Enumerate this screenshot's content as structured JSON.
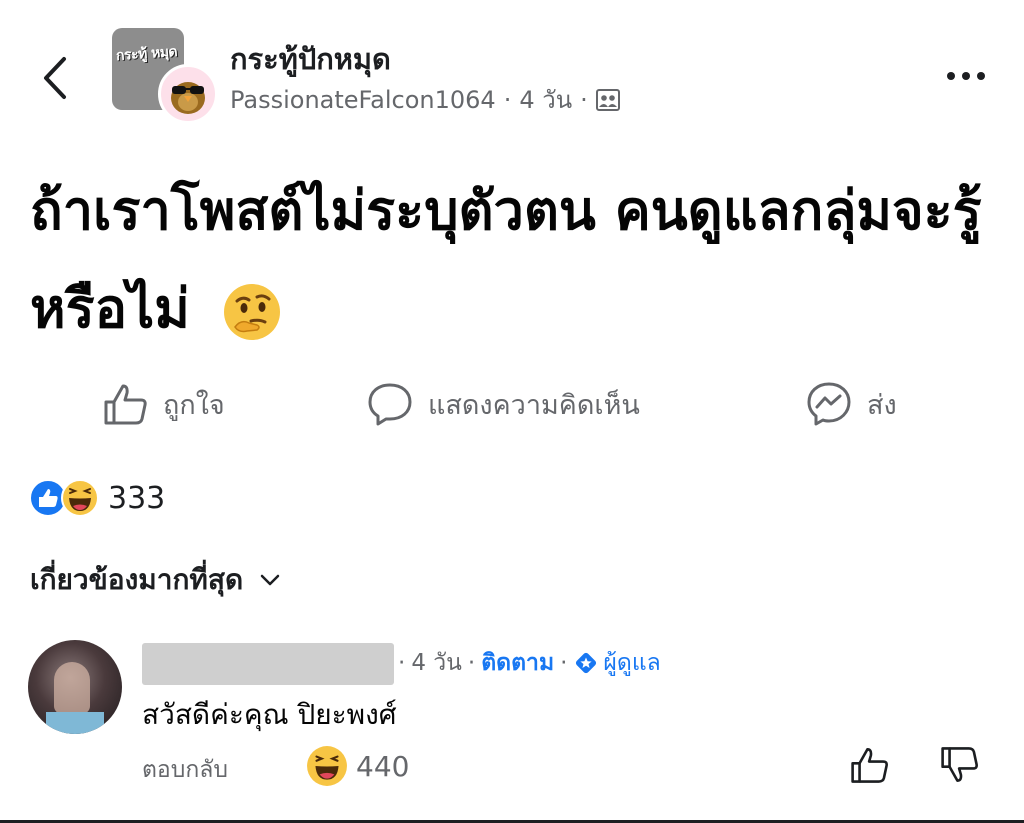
{
  "header": {
    "group_name": "กระทู้ปักหมุด",
    "group_thumb_label": "กระทู้ หมุด",
    "author": "PassionateFalcon1064",
    "time": "4 วัน"
  },
  "post": {
    "text": "ถ้าเราโพสต์ไม่ระบุตัวตน คนดูแลกลุ่มจะรู้หรือไม่"
  },
  "actions": {
    "like_label": "ถูกใจ",
    "comment_label": "แสดงความคิดเห็น",
    "share_label": "ส่ง"
  },
  "reactions": {
    "count": "333"
  },
  "sort": {
    "label": "เกี่ยวข้องมากที่สุด"
  },
  "comment": {
    "time": "4 วัน",
    "follow_label": "ติดตาม",
    "admin_label": "ผู้ดูแล",
    "text": "สวัสดีค่ะคุณ ปิยะพงศ์",
    "reply_label": "ตอบกลับ",
    "reaction_count": "440"
  },
  "colors": {
    "accent": "#1877f2",
    "secondary_text": "#65676b",
    "primary_text": "#050505",
    "haha_yellow": "#f7c544"
  }
}
